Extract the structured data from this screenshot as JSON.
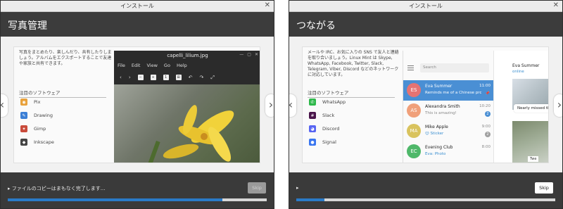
{
  "windows": [
    {
      "title": "インストール",
      "heading": "写真管理",
      "description": "写真をまとめたり、楽しんだり、共有したりしましょう。アルバムをエクスポートすることで友達や家族と共有できます。",
      "section_title": "注目のソフトウェア",
      "software": [
        {
          "name": "Pix",
          "icon": "pix-icon",
          "color": "#e8a13a"
        },
        {
          "name": "Drawing",
          "icon": "drawing-icon",
          "color": "#3b7fd6"
        },
        {
          "name": "Gimp",
          "icon": "gimp-icon",
          "color": "#c94b3b"
        },
        {
          "name": "Inkscape",
          "icon": "inkscape-icon",
          "color": "#444444"
        }
      ],
      "app": {
        "title": "capelli_lilium.jpg",
        "menu": [
          "File",
          "Edit",
          "View",
          "Go",
          "Help"
        ]
      },
      "status": "ファイルのコピーはまもなく完了します...",
      "skip_label": "Skip",
      "skip_enabled": false,
      "progress": 0.83
    },
    {
      "title": "インストール",
      "heading": "つながる",
      "description": "メールや IRC、お気に入りの SNS で友人と連絡を取り合いましょう。Linux Mint は Skype, WhatsApp, Facebook, Twitter, Slack, Telegram, Viber, Discord などのネットワークに対応しています。",
      "section_title": "注目のソフトウェア",
      "software": [
        {
          "name": "WhatsApp",
          "icon": "whatsapp-icon",
          "color": "#2eb84b"
        },
        {
          "name": "Slack",
          "icon": "slack-icon",
          "color": "#4a154b"
        },
        {
          "name": "Discord",
          "icon": "discord-icon",
          "color": "#5865f2"
        },
        {
          "name": "Signal",
          "icon": "signal-icon",
          "color": "#3a76f0"
        }
      ],
      "chat": {
        "search_placeholder": "Search",
        "conversations": [
          {
            "initials": "ES",
            "name": "Eva Summer",
            "preview": "Reminds me of a Chinese prover...",
            "time": "11:00",
            "badge": "",
            "color": "#e57373"
          },
          {
            "initials": "AS",
            "name": "Alexandra Smith",
            "preview": "This is amazing!",
            "time": "10:20",
            "badge": "2",
            "color": "#f0a07a"
          },
          {
            "initials": "MA",
            "name": "Mike Apple",
            "preview": "😊 Sticker",
            "time": "9:00",
            "badge": "2",
            "color": "#d9c35e"
          },
          {
            "initials": "EC",
            "name": "Evening Club",
            "preview": "Eva: Photo",
            "time": "8:00",
            "badge": "",
            "color": "#4fb86a"
          }
        ],
        "contact_name": "Eva Summer",
        "contact_status": "online",
        "bubble": "Nearly missed this sunrise",
        "tw": "Twe"
      },
      "status": "",
      "skip_label": "Skip",
      "skip_enabled": true,
      "progress": 0.11
    }
  ]
}
